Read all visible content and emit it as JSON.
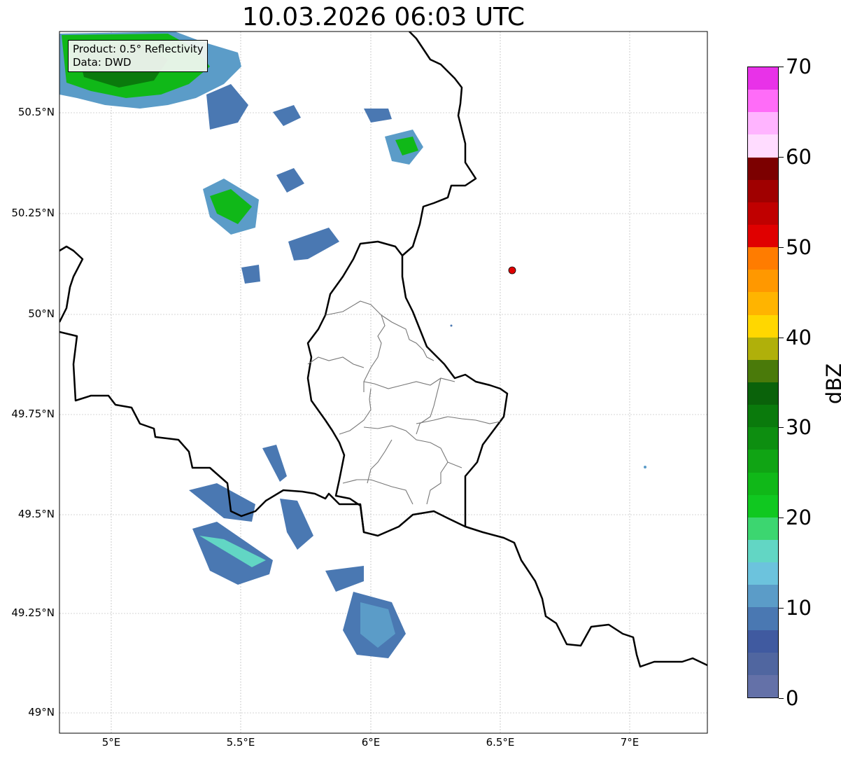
{
  "title": "10.03.2026 06:03 UTC",
  "info": {
    "product": "Product: 0.5° Reflectivity",
    "data": "Data: DWD"
  },
  "lat_labels": [
    "50.5°N",
    "50.25°N",
    "50°N",
    "49.75°N",
    "49.5°N",
    "49.25°N",
    "49°N"
  ],
  "lon_labels": [
    "5°E",
    "5.5°E",
    "6°E",
    "6.5°E",
    "7°E"
  ],
  "colorbar": {
    "unit": "dBZ",
    "tick_labels": [
      "0",
      "10",
      "20",
      "30",
      "40",
      "50",
      "60",
      "70"
    ],
    "colors": [
      "#6471a8",
      "#5066a0",
      "#405aa0",
      "#4a78b2",
      "#5b9cc8",
      "#6cc3dd",
      "#62d6c4",
      "#3cd670",
      "#10c820",
      "#10b818",
      "#10a414",
      "#0d8e10",
      "#0a7a0c",
      "#0a620a",
      "#4a7a0a",
      "#b0b00a",
      "#ffd700",
      "#ffb400",
      "#ff9800",
      "#ff7c00",
      "#e00000",
      "#c00000",
      "#a00000",
      "#7c0000",
      "#ffdcff",
      "#ffb4ff",
      "#ff6cf8",
      "#e832e8"
    ]
  },
  "station_marker": {
    "lat": 50.11,
    "lon": 6.55,
    "color": "#e00000"
  }
}
